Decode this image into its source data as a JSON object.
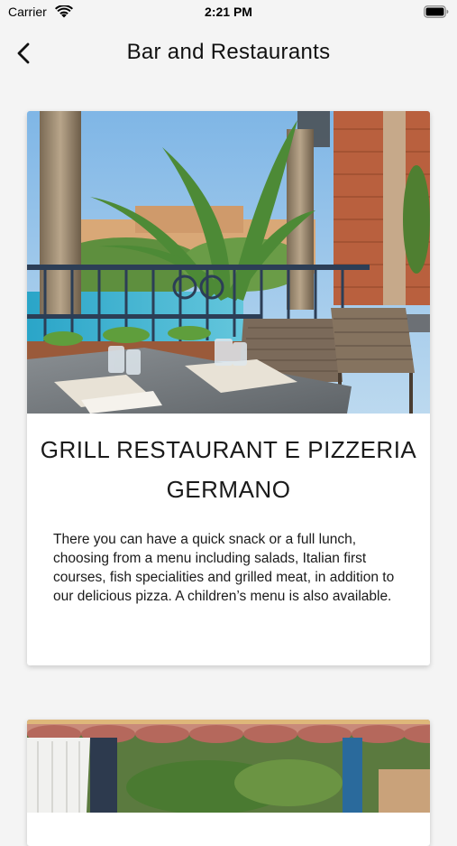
{
  "status_bar": {
    "carrier": "Carrier",
    "time": "2:21 PM"
  },
  "nav": {
    "title": "Bar and Restaurants",
    "back_icon": "chevron-left-icon"
  },
  "restaurants": [
    {
      "title": "GRILL RESTAURANT E PIZZERIA GERMANO",
      "description": "There you can have a quick snack or a full lunch, choosing from a menu including salads, Italian first courses, fish specialities and grilled meat, in addition to our delicious pizza. A children’s menu is also available."
    }
  ],
  "colors": {
    "background": "#f4f4f4",
    "card": "#ffffff",
    "text": "#111111"
  }
}
